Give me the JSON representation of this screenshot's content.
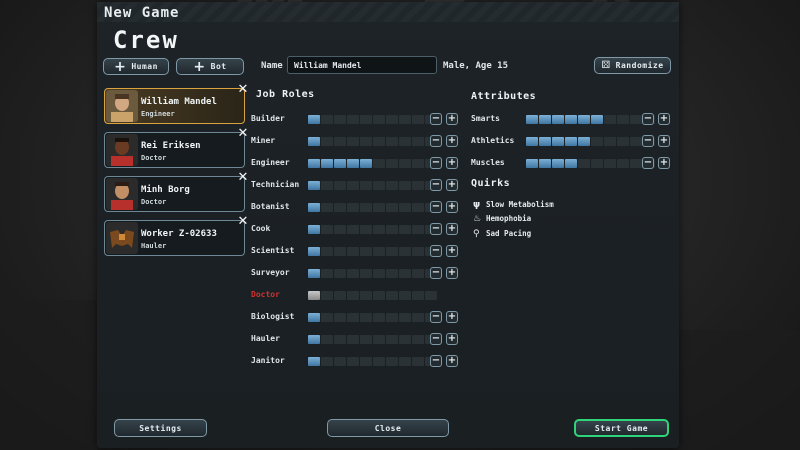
{
  "header": {
    "new_game": "New Game",
    "crew": "Crew"
  },
  "buttons": {
    "human": "Human",
    "bot": "Bot",
    "randomize": "Randomize"
  },
  "name_field": {
    "label": "Name",
    "value": "William Mandel",
    "age_text": "Male, Age 15"
  },
  "crew": [
    {
      "name": "William Mandel",
      "role": "Engineer",
      "selected": true
    },
    {
      "name": "Rei Eriksen",
      "role": "Doctor",
      "selected": false
    },
    {
      "name": "Minh Borg",
      "role": "Doctor",
      "selected": false
    },
    {
      "name": "Worker Z-02633",
      "role": "Hauler",
      "selected": false
    }
  ],
  "job_roles": {
    "title": "Job Roles",
    "items": [
      {
        "label": "Builder",
        "level": 1,
        "max": 10,
        "disabled": false
      },
      {
        "label": "Miner",
        "level": 1,
        "max": 10,
        "disabled": false
      },
      {
        "label": "Engineer",
        "level": 5,
        "max": 10,
        "disabled": false
      },
      {
        "label": "Technician",
        "level": 1,
        "max": 10,
        "disabled": false
      },
      {
        "label": "Botanist",
        "level": 1,
        "max": 10,
        "disabled": false
      },
      {
        "label": "Cook",
        "level": 1,
        "max": 10,
        "disabled": false
      },
      {
        "label": "Scientist",
        "level": 1,
        "max": 10,
        "disabled": false
      },
      {
        "label": "Surveyor",
        "level": 1,
        "max": 10,
        "disabled": false
      },
      {
        "label": "Doctor",
        "level": 1,
        "max": 10,
        "disabled": true
      },
      {
        "label": "Biologist",
        "level": 1,
        "max": 10,
        "disabled": false
      },
      {
        "label": "Hauler",
        "level": 1,
        "max": 10,
        "disabled": false
      },
      {
        "label": "Janitor",
        "level": 1,
        "max": 10,
        "disabled": false
      }
    ]
  },
  "attributes": {
    "title": "Attributes",
    "items": [
      {
        "label": "Smarts",
        "level": 6,
        "max": 10
      },
      {
        "label": "Athletics",
        "level": 5,
        "max": 10
      },
      {
        "label": "Muscles",
        "level": 4,
        "max": 10
      }
    ]
  },
  "quirks": {
    "title": "Quirks",
    "items": [
      {
        "label": "Slow Metabolism",
        "icon": "fork-knife-icon"
      },
      {
        "label": "Hemophobia",
        "icon": "blood-drop-icon"
      },
      {
        "label": "Sad Pacing",
        "icon": "walking-person-icon"
      }
    ]
  },
  "footer": {
    "settings": "Settings",
    "close": "Close",
    "start": "Start Game"
  },
  "colors": {
    "accent_bar": "#4f8bbd",
    "selected_card": "#d9a340",
    "start_border": "#2fd37a",
    "disabled_role": "#d0332e"
  }
}
